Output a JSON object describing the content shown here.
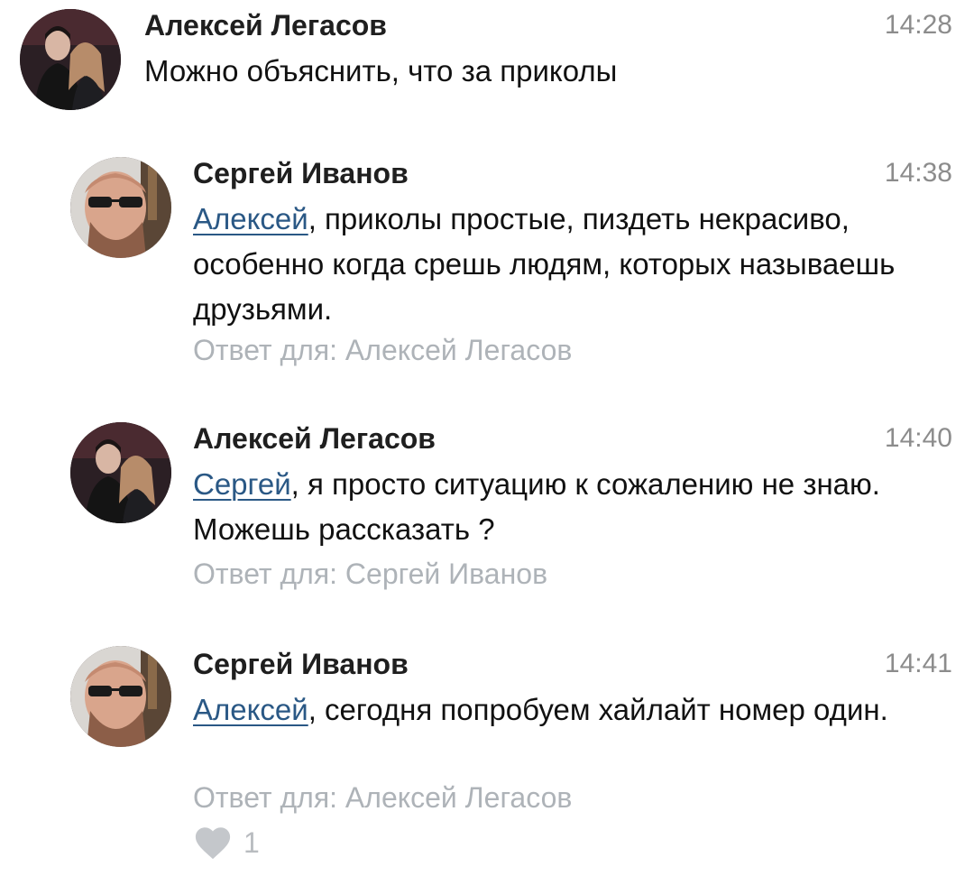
{
  "comments": [
    {
      "author": "Алексей Легасов",
      "time": "14:28",
      "text": "Можно объяснить, что за приколы",
      "avatar": "couple-photo-avatar"
    },
    {
      "author": "Сергей Иванов",
      "time": "14:38",
      "mention": "Алексей",
      "text": ", приколы простые, пиздеть некрасиво, особенно когда срешь людям, которых называешь друзьями.",
      "reply_label": "Ответ для: Алексей Легасов",
      "avatar": "man-sunglasses-avatar"
    },
    {
      "author": "Алексей Легасов",
      "time": "14:40",
      "mention": "Сергей",
      "text": ", я просто ситуацию к сожалению не знаю. Можешь рассказать ?",
      "reply_label": "Ответ для: Сергей Иванов",
      "avatar": "couple-photo-avatar"
    },
    {
      "author": "Сергей Иванов",
      "time": "14:41",
      "mention": "Алексей",
      "text": ", сегодня попробуем хайлайт номер один.",
      "reply_label": "Ответ для: Алексей Легасов",
      "avatar": "man-sunglasses-avatar",
      "likes": "1"
    }
  ],
  "colors": {
    "mention": "#2a5885",
    "meta": "#8c8c8c",
    "reply": "#aeb3b8",
    "like": "#c4c7cb"
  }
}
